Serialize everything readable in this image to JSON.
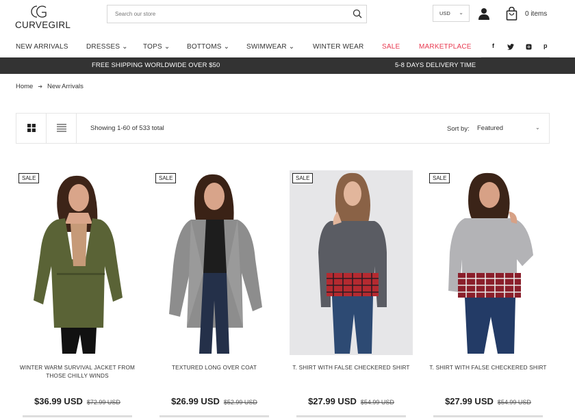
{
  "brand": {
    "logo_text": "CURVEGIRL"
  },
  "search": {
    "placeholder": "Search our store",
    "icon": "search-icon"
  },
  "header": {
    "currency": "USD",
    "cart_label": "0 items"
  },
  "nav": {
    "items": [
      {
        "label": "NEW ARRIVALS",
        "dropdown": false
      },
      {
        "label": "DRESSES ⌄",
        "dropdown": true
      },
      {
        "label": "TOPS ⌄",
        "dropdown": true
      },
      {
        "label": "BOTTOMS ⌄",
        "dropdown": true
      },
      {
        "label": "SWIMWEAR ⌄",
        "dropdown": true
      },
      {
        "label": "WINTER WEAR",
        "dropdown": false
      },
      {
        "label": "SALE",
        "dropdown": false,
        "color": "#e8384f"
      },
      {
        "label": "MARKETPLACE",
        "dropdown": false,
        "color": "#e8384f"
      }
    ],
    "social": [
      "f",
      "t",
      "instagram",
      "p"
    ]
  },
  "banner": {
    "left": "FREE SHIPPING WORLDWIDE OVER $50",
    "right": "5-8 DAYS DELIVERY TIME",
    "background": "#333333"
  },
  "breadcrumb": {
    "home": "Home",
    "current": "New Arrivals"
  },
  "toolbar": {
    "showing": "Showing 1-60 of 533 total",
    "sort_label": "Sort by:",
    "sort_value": "Featured"
  },
  "products": [
    {
      "badge": "SALE",
      "title": "WINTER WARM SURVIVAL JACKET FROM THOSE CHILLY WINDS",
      "price": "$36.99 USD",
      "old_price": "$72.99 USD",
      "image": "olive-green-parka-jacket"
    },
    {
      "badge": "SALE",
      "title": "TEXTURED LONG OVER COAT",
      "price": "$26.99 USD",
      "old_price": "$52.99 USD",
      "image": "grey-textured-long-coat"
    },
    {
      "badge": "SALE",
      "title": "T. SHIRT WITH FALSE CHECKERED SHIRT",
      "price": "$27.99 USD",
      "old_price": "$54.99 USD",
      "image": "grey-sweatshirt-red-plaid-hem"
    },
    {
      "badge": "SALE",
      "title": "T. SHIRT WITH FALSE CHECKERED SHIRT",
      "price": "$27.99 USD",
      "old_price": "$54.99 USD",
      "image": "light-grey-sweatshirt-plaid-hem"
    }
  ]
}
